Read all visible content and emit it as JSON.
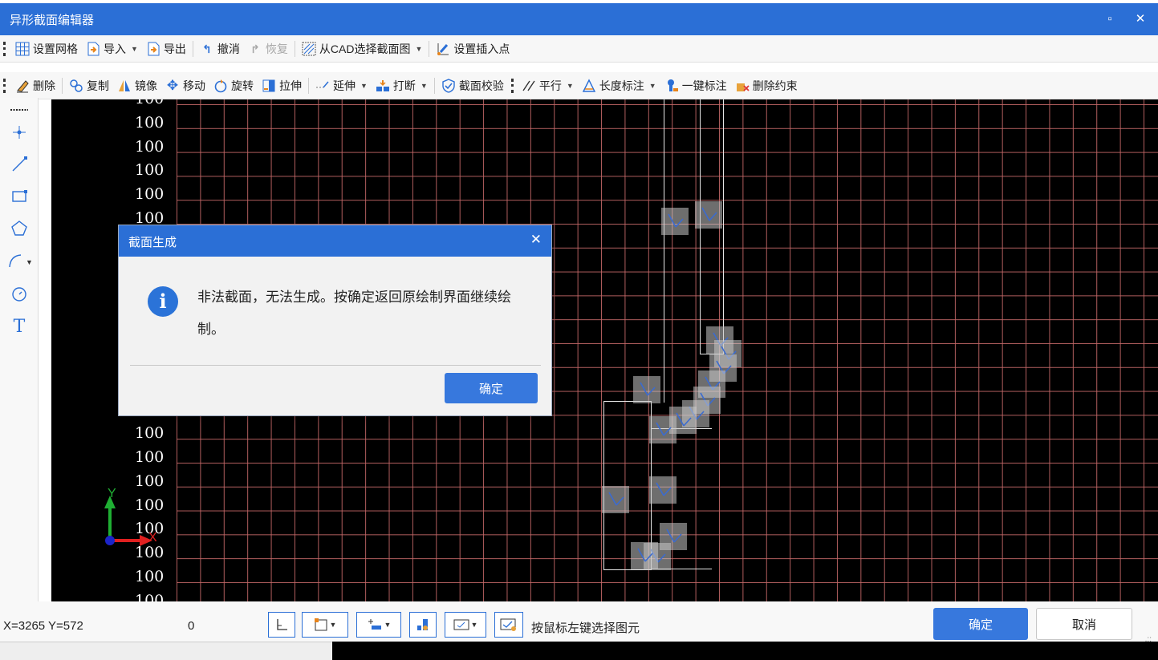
{
  "window": {
    "title": "异形截面编辑器",
    "maximize_icon": "maximize-icon",
    "close_icon": "close-icon"
  },
  "toolbar1": {
    "items": [
      {
        "label": "设置网格",
        "icon": "grid-icon"
      },
      {
        "label": "导入",
        "icon": "import-icon",
        "dropdown": true
      },
      {
        "label": "导出",
        "icon": "export-icon"
      },
      {
        "label": "撤消",
        "icon": "undo-icon"
      },
      {
        "label": "恢复",
        "icon": "redo-icon",
        "disabled": true
      },
      {
        "label": "从CAD选择截面图",
        "icon": "cad-select-icon",
        "dropdown": true
      },
      {
        "label": "设置插入点",
        "icon": "insert-point-icon"
      }
    ]
  },
  "toolbar2": {
    "items": [
      {
        "label": "删除",
        "icon": "eraser-icon"
      },
      {
        "label": "复制",
        "icon": "copy-icon"
      },
      {
        "label": "镜像",
        "icon": "mirror-icon"
      },
      {
        "label": "移动",
        "icon": "move-icon"
      },
      {
        "label": "旋转",
        "icon": "rotate-icon"
      },
      {
        "label": "拉伸",
        "icon": "stretch-icon"
      },
      {
        "label": "延伸",
        "icon": "extend-icon",
        "dropdown": true
      },
      {
        "label": "打断",
        "icon": "break-icon",
        "dropdown": true
      },
      {
        "label": "截面校验",
        "icon": "check-icon"
      },
      {
        "label": "平行",
        "icon": "parallel-icon",
        "dropdown": true
      },
      {
        "label": "长度标注",
        "icon": "dimension-icon",
        "dropdown": true
      },
      {
        "label": "一键标注",
        "icon": "auto-dimension-icon"
      },
      {
        "label": "删除约束",
        "icon": "delete-constraint-icon"
      }
    ]
  },
  "left_tools": [
    "dotted-line-icon",
    "point-icon",
    "line-icon",
    "rectangle-icon",
    "polygon-icon",
    "arc-icon",
    "circle-icon",
    "text-icon"
  ],
  "left_tools_text": {
    "text_tool": "T"
  },
  "canvas": {
    "y_labels": [
      "100",
      "100",
      "100",
      "100",
      "100",
      "100",
      "100",
      "100",
      "100",
      "100",
      "100",
      "100",
      "100",
      "100",
      "100",
      "100",
      "100",
      "100",
      "100",
      "100",
      "100",
      "100"
    ],
    "axis_y": "Y",
    "axis_x": "X"
  },
  "dialog": {
    "title": "截面生成",
    "message": "非法截面，无法生成。按确定返回原绘制界面继续绘制。",
    "ok": "确定",
    "icon": "info-icon"
  },
  "status": {
    "coords": "X=3265 Y=572",
    "value": "0",
    "hint": "按鼠标左键选择图元",
    "ok": "确定",
    "cancel": "取消"
  },
  "colors": {
    "accent": "#2b6fd6",
    "canvas_bg": "#000000",
    "grid": "#c46868",
    "axis_y": "#1fae33",
    "axis_x": "#e02020"
  }
}
